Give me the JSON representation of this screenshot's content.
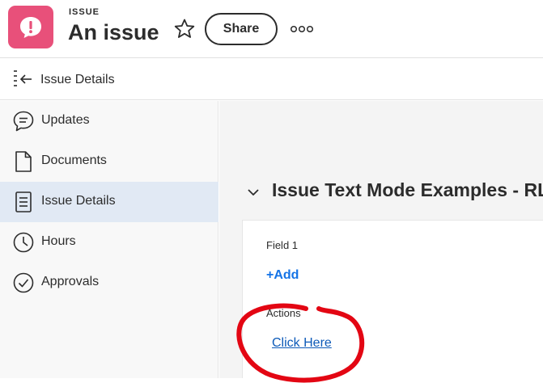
{
  "header": {
    "object_type": "ISSUE",
    "title": "An issue",
    "share_label": "Share",
    "app_icon": "issue-alert-icon",
    "brand_color": "#e8507a"
  },
  "subbar": {
    "title": "Issue Details",
    "icon": "collapse-panel-icon"
  },
  "sidebar": {
    "items": [
      {
        "label": "Updates",
        "icon": "speech-bubble-icon",
        "active": false
      },
      {
        "label": "Documents",
        "icon": "document-icon",
        "active": false
      },
      {
        "label": "Issue Details",
        "icon": "details-list-icon",
        "active": true
      },
      {
        "label": "Hours",
        "icon": "clock-icon",
        "active": false
      },
      {
        "label": "Approvals",
        "icon": "checkmark-circle-icon",
        "active": false
      }
    ]
  },
  "main": {
    "section_title": "Issue Text Mode Examples - RL (",
    "fields": [
      {
        "label": "Field 1",
        "action": "+Add"
      },
      {
        "label": "Actions",
        "link": "Click Here"
      }
    ],
    "annotation_color": "#e30613"
  }
}
